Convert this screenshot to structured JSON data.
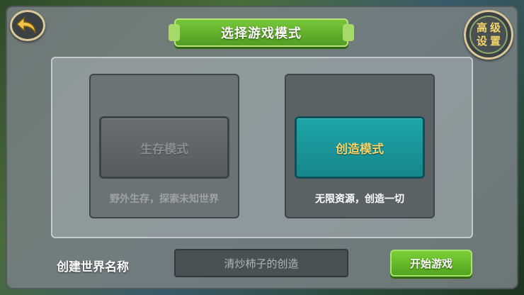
{
  "header": {
    "title": "选择游戏模式",
    "back_icon": "back-arrow-icon",
    "advanced_settings_line1": "高级",
    "advanced_settings_line2": "设置"
  },
  "modes": [
    {
      "label": "生存模式",
      "description": "野外生存，探索未知世界",
      "state": "disabled"
    },
    {
      "label": "创造模式",
      "description": "无限资源，创造一切",
      "state": "selected"
    }
  ],
  "world": {
    "label": "创建世界名称",
    "name_value": "清炒柿子的创造"
  },
  "actions": {
    "start_label": "开始游戏"
  },
  "colors": {
    "accent_green": "#5fb52a",
    "creative_teal": "#1a9a9e",
    "gold_text": "#f3d66b"
  }
}
